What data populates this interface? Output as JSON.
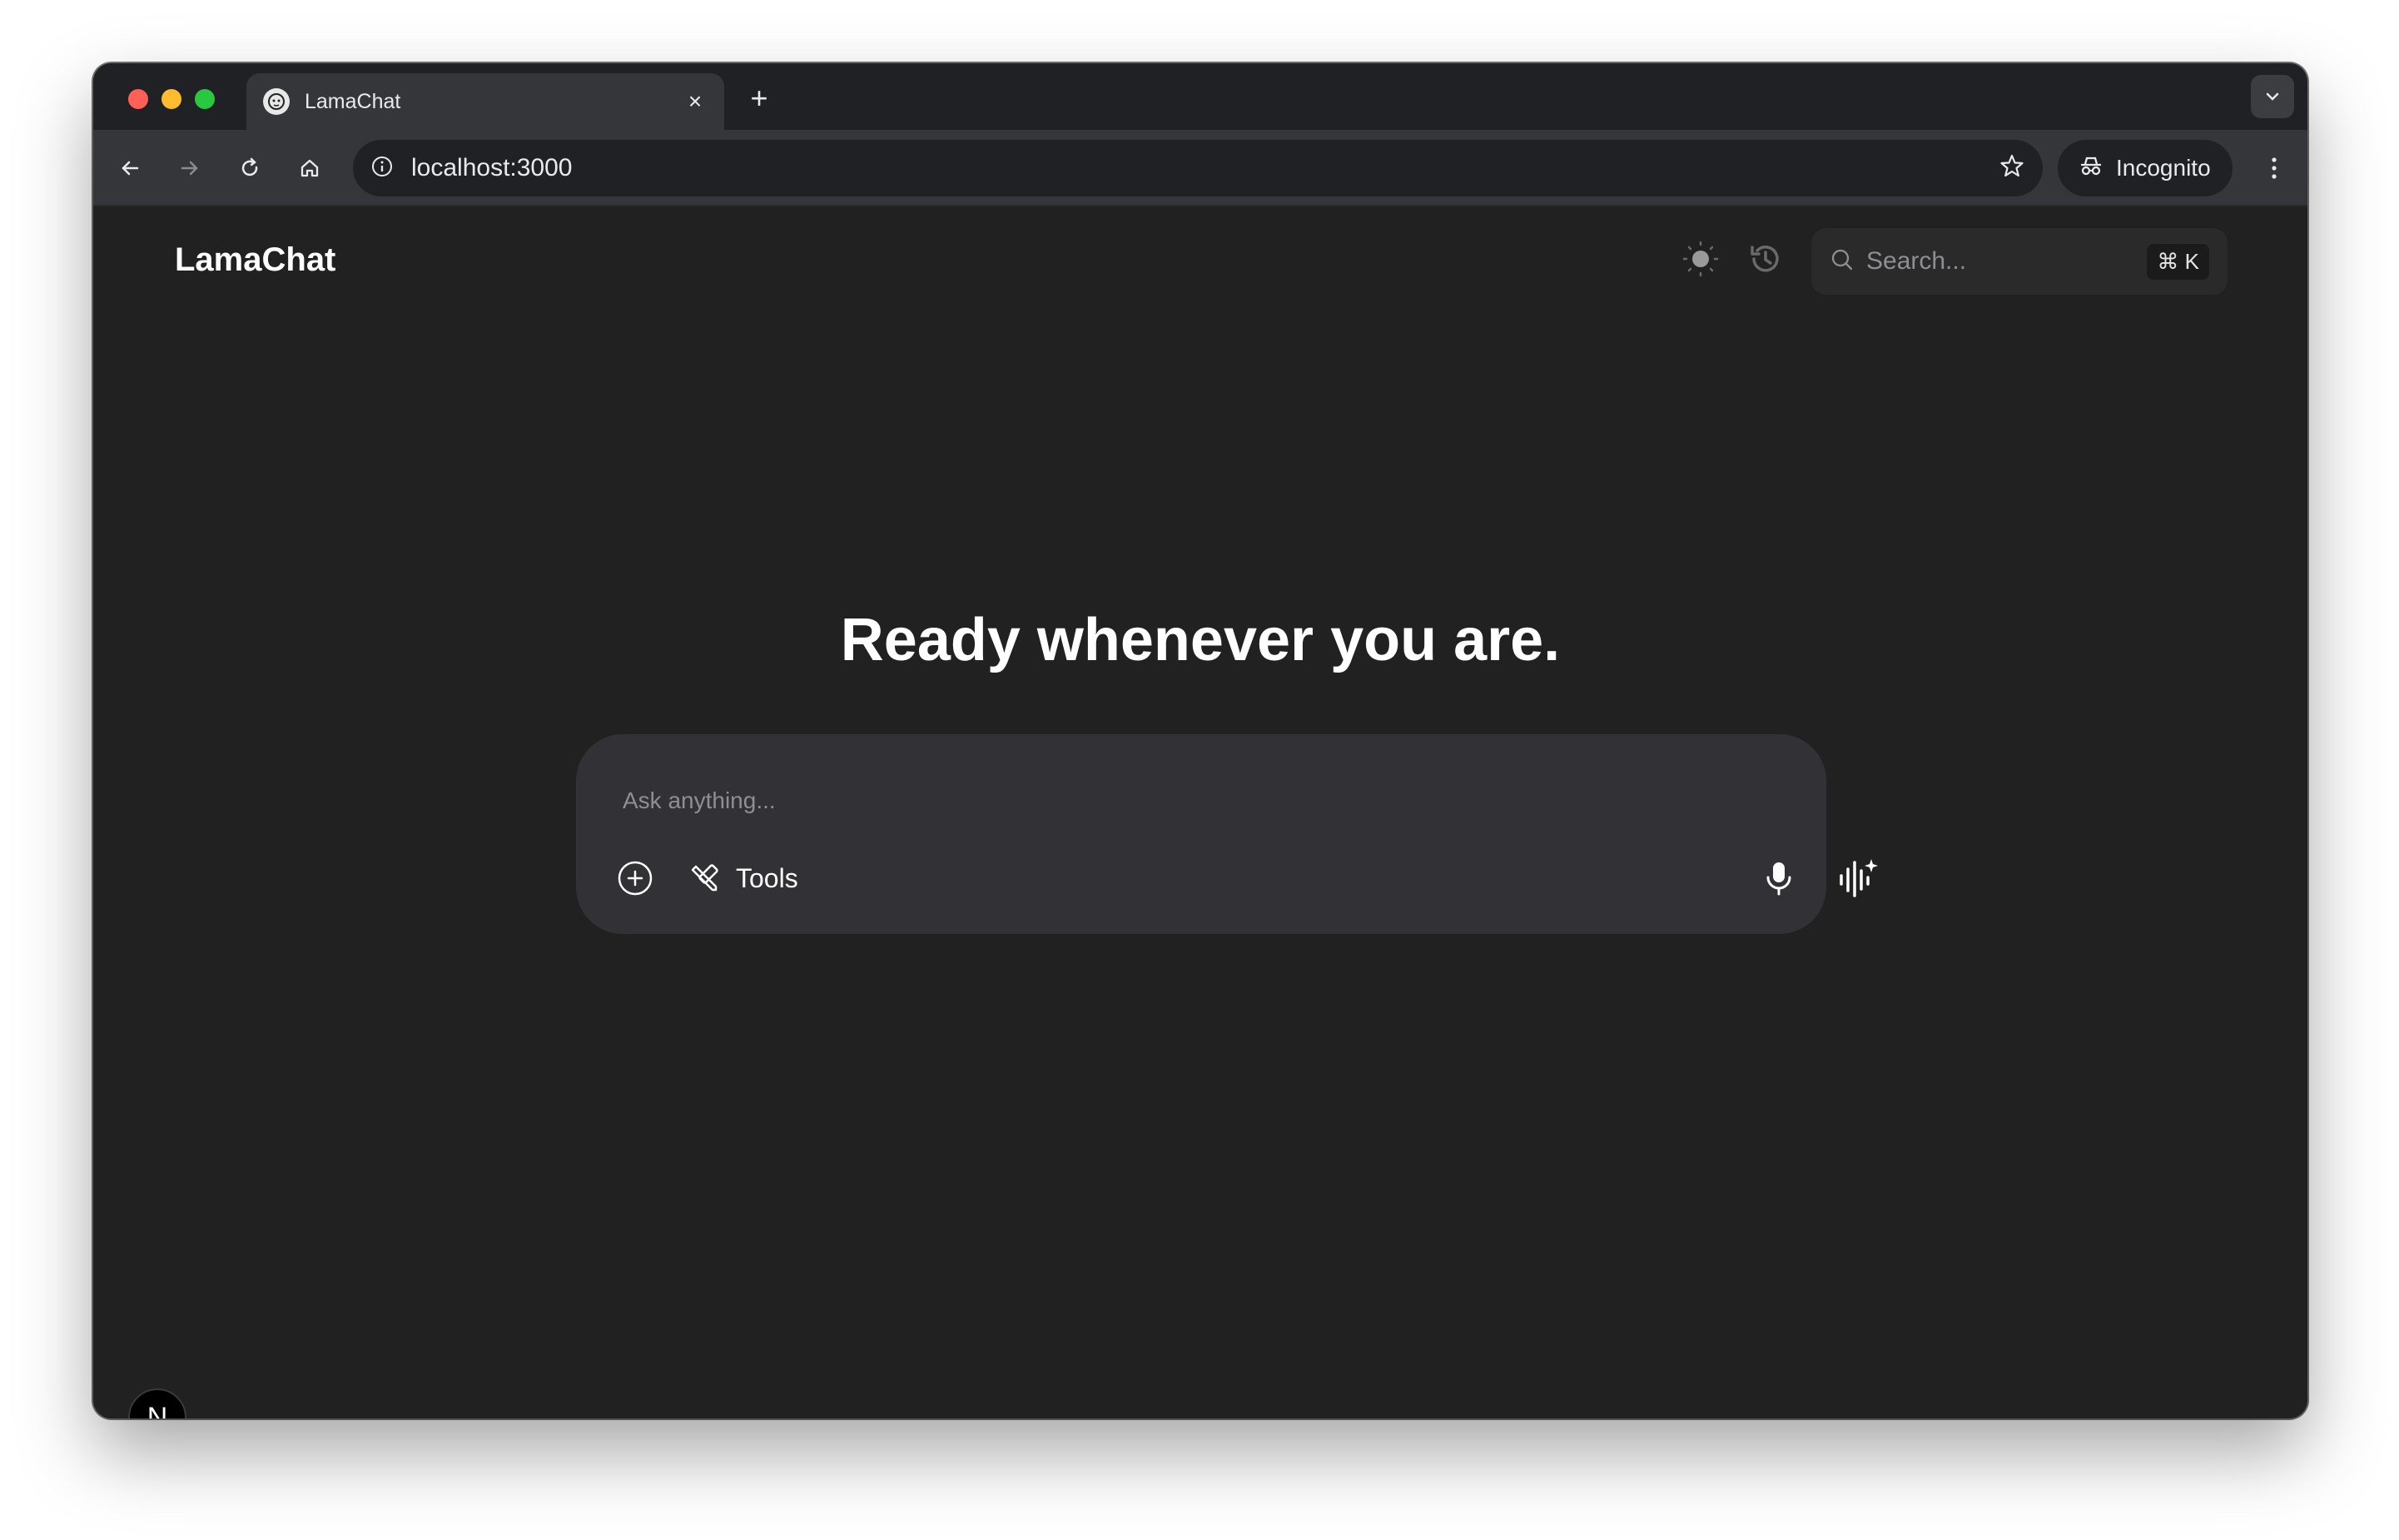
{
  "browser": {
    "tab": {
      "title": "LamaChat",
      "close_icon": "close-icon"
    },
    "address": {
      "url": "localhost:3000"
    },
    "incognito_label": "Incognito"
  },
  "header": {
    "logo": "LamaChat",
    "search": {
      "placeholder": "Search...",
      "shortcut": "⌘ K"
    }
  },
  "main": {
    "headline": "Ready whenever you are.",
    "composer": {
      "placeholder": "Ask anything...",
      "tools_label": "Tools"
    }
  },
  "dev_badge": {
    "letter": "N"
  },
  "colors": {
    "page_bg": "#212121",
    "composer_bg": "#323236",
    "text_primary": "#ffffff",
    "text_muted": "#8e8e93"
  }
}
